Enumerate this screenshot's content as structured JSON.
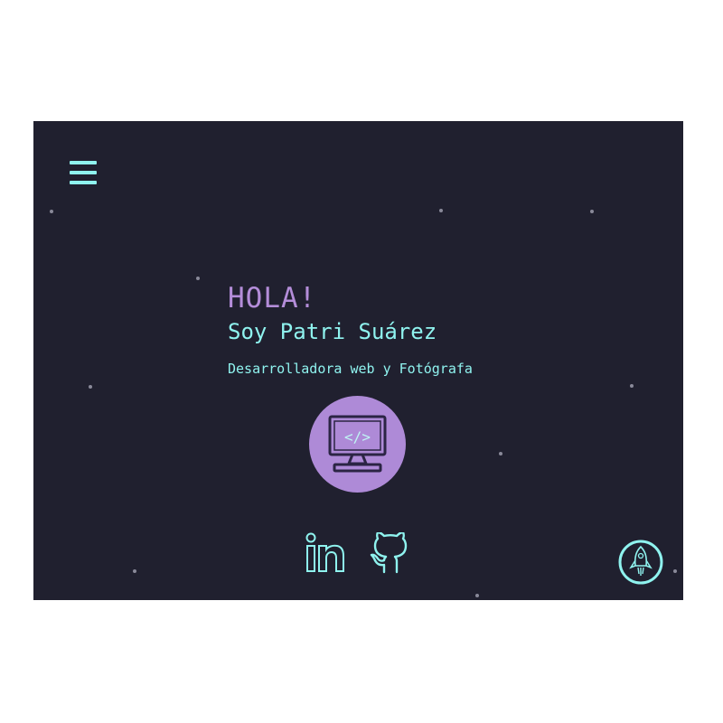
{
  "header": {
    "menu_icon": "hamburger-menu-icon"
  },
  "hero": {
    "greeting": "HOLA!",
    "name": "Soy Patri Suárez",
    "subtitle": "Desarrolladora web y Fotógrafa",
    "avatar_icon": "computer-code-icon",
    "avatar_code_text": "</>"
  },
  "social": {
    "linkedin_icon": "linkedin-icon",
    "github_icon": "github-icon"
  },
  "scroll_top": {
    "icon": "rocket-icon"
  },
  "colors": {
    "background": "#20202f",
    "accent_cyan": "#8ff3ef",
    "accent_purple": "#b48dd9",
    "avatar_bg": "#ae8ad7",
    "avatar_icon": "#2b2444"
  }
}
